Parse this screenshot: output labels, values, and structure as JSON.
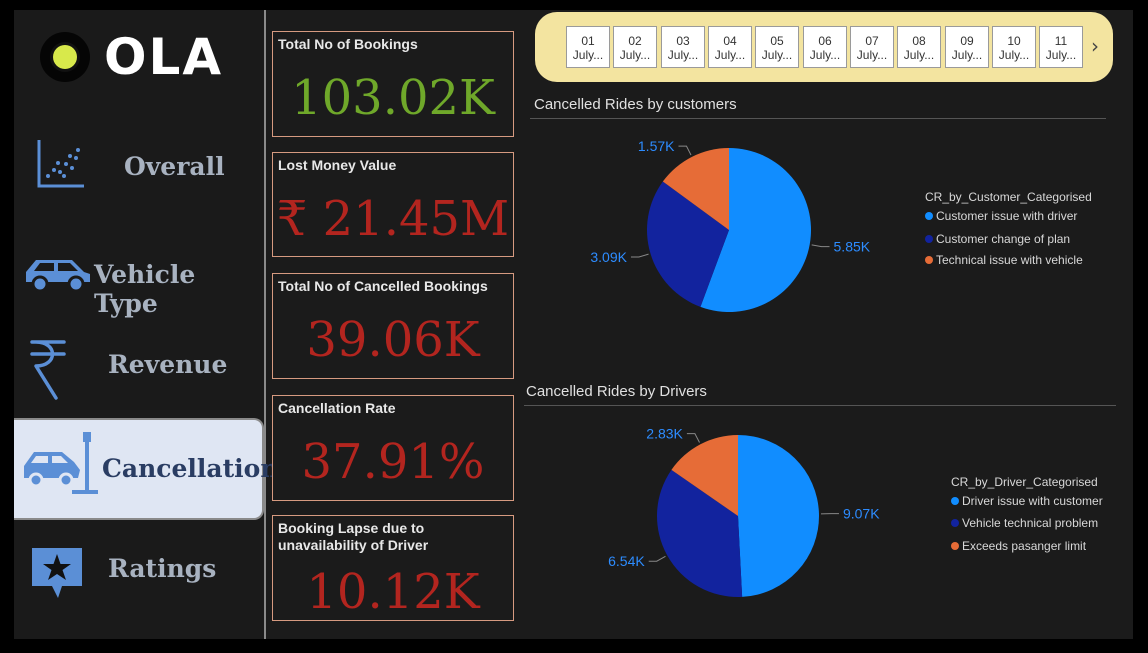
{
  "brand": {
    "logo_text": "OLA"
  },
  "nav": [
    {
      "label": "Overall",
      "icon": "scatter-chart-icon"
    },
    {
      "label": "Vehicle Type",
      "icon": "car-icon"
    },
    {
      "label": "Revenue",
      "icon": "rupee-icon"
    },
    {
      "label": "Cancellation",
      "icon": "car-crash-icon",
      "active": true
    },
    {
      "label": "Ratings",
      "icon": "star-review-icon"
    }
  ],
  "kpis": [
    {
      "title": "Total No of Bookings",
      "value": "103.02K",
      "color": "#6fa82a"
    },
    {
      "title": "Lost Money Value",
      "value": "₹ 21.45M",
      "color": "#b3251f"
    },
    {
      "title": "Total No of Cancelled Bookings",
      "value": "39.06K",
      "color": "#b3251f"
    },
    {
      "title": "Cancellation Rate",
      "value": "37.91%",
      "color": "#b3251f"
    },
    {
      "title": "Booking Lapse due to unavailability of Driver",
      "value": "10.12K",
      "color": "#b3251f"
    }
  ],
  "date_slicer": {
    "dates": [
      {
        "day": "01",
        "month": "July..."
      },
      {
        "day": "02",
        "month": "July..."
      },
      {
        "day": "03",
        "month": "July..."
      },
      {
        "day": "04",
        "month": "July..."
      },
      {
        "day": "05",
        "month": "July..."
      },
      {
        "day": "06",
        "month": "July..."
      },
      {
        "day": "07",
        "month": "July..."
      },
      {
        "day": "08",
        "month": "July..."
      },
      {
        "day": "09",
        "month": "July..."
      },
      {
        "day": "10",
        "month": "July..."
      },
      {
        "day": "11",
        "month": "July..."
      }
    ],
    "next_arrow": "›"
  },
  "chart_data": [
    {
      "type": "pie",
      "title": "Cancelled Rides by customers",
      "legend_title": "CR_by_Customer_Categorised",
      "legend_position": "right",
      "slices": [
        {
          "name": "Customer issue with driver",
          "value": 5850,
          "label": "5.85K",
          "color": "#118dff"
        },
        {
          "name": "Customer change of plan",
          "value": 3090,
          "label": "3.09K",
          "color": "#12239e"
        },
        {
          "name": "Technical issue with vehicle",
          "value": 1570,
          "label": "1.57K",
          "color": "#e66c37"
        }
      ]
    },
    {
      "type": "pie",
      "title": "Cancelled Rides by Drivers",
      "legend_title": "CR_by_Driver_Categorised",
      "legend_position": "right",
      "slices": [
        {
          "name": "Driver issue with customer",
          "value": 9070,
          "label": "9.07K",
          "color": "#118dff"
        },
        {
          "name": "Vehicle technical problem",
          "value": 6540,
          "label": "6.54K",
          "color": "#12239e"
        },
        {
          "name": "Exceeds pasanger limit",
          "value": 2830,
          "label": "2.83K",
          "color": "#e66c37"
        }
      ]
    }
  ]
}
